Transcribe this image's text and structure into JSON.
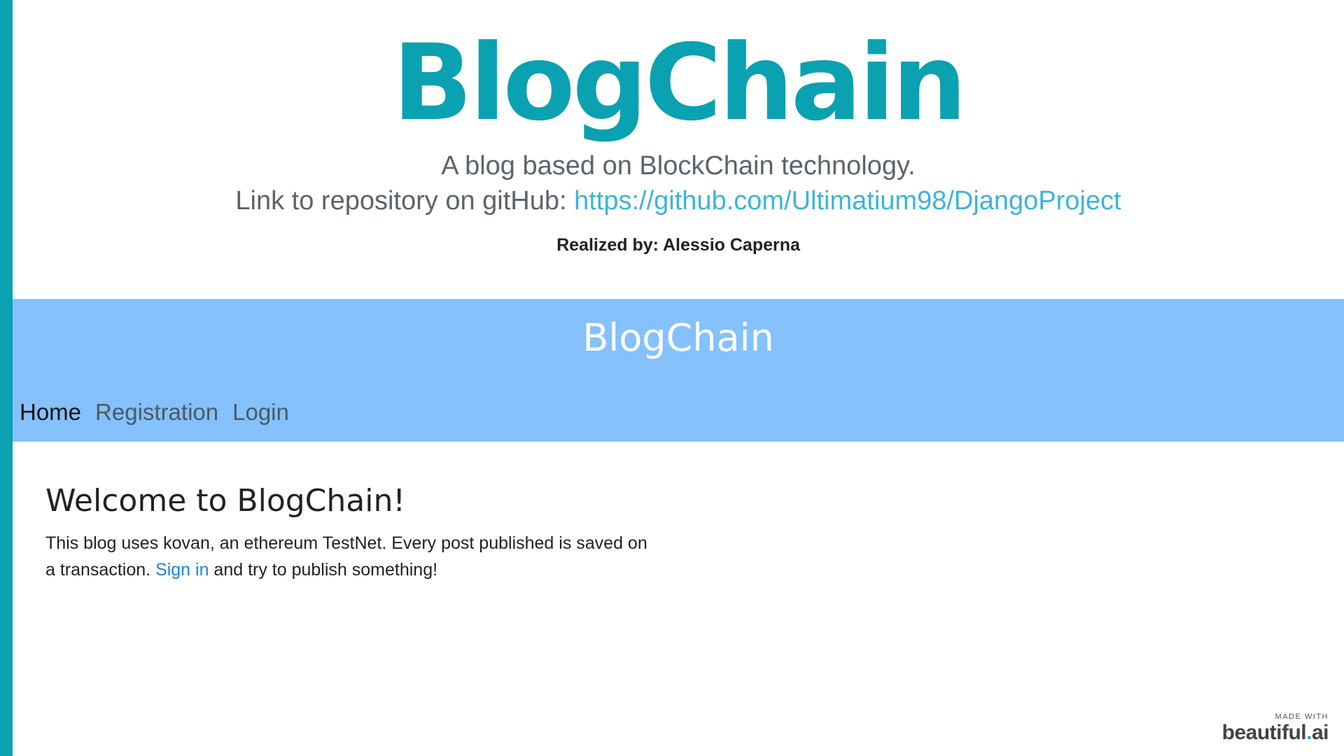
{
  "slide": {
    "title": "BlogChain",
    "subtitle": "A blog based on BlockChain technology.",
    "repo_prefix": "Link to repository on gitHub: ",
    "repo_url": "https://github.com/Ultimatium98/DjangoProject",
    "credits": "Realized by: Alessio Caperna"
  },
  "app": {
    "brand": "BlogChain",
    "nav": [
      {
        "label": "Home",
        "active": true
      },
      {
        "label": "Registration",
        "active": false
      },
      {
        "label": "Login",
        "active": false
      }
    ],
    "welcome_heading": "Welcome to BlogChain!",
    "intro_before": "This blog uses kovan, an ethereum TestNet. Every post published is saved on a transaction. ",
    "intro_link": "Sign in",
    "intro_after": " and try to publish something!"
  },
  "watermark": {
    "made_with": "MADE WITH",
    "brand_main": "beautiful",
    "brand_dot": ".",
    "brand_suffix": "ai"
  },
  "colors": {
    "accent": "#0aa1b1",
    "navbar": "#84c1fd",
    "link": "#3fb3d8"
  }
}
